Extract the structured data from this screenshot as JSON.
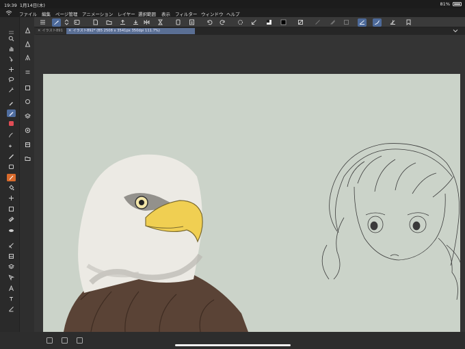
{
  "status_bar": {
    "time": "19:39",
    "date": "1月14日(木)",
    "battery": "81%",
    "battery_level": 0.81
  },
  "menu": {
    "items": [
      "ファイル",
      "編集",
      "ページ管理",
      "アニメーション",
      "レイヤー",
      "選択範囲",
      "表示",
      "フィルター",
      "ウィンドウ",
      "ヘルプ"
    ]
  },
  "tabs": [
    {
      "label": "イラスト891",
      "active": false
    },
    {
      "label": "イラスト892* (B5 2508 x 3541px 350dpi 111.7%)",
      "active": true
    }
  ],
  "colors": {
    "accent": "#4f6d9f",
    "canvas_bg": "#cbd3c9",
    "main_color": "#0a0a0a",
    "sub_color": "#ffffff"
  },
  "icons": {
    "cloud": "wifi-cloud-icon",
    "collapse": "chevron-down-icon"
  }
}
